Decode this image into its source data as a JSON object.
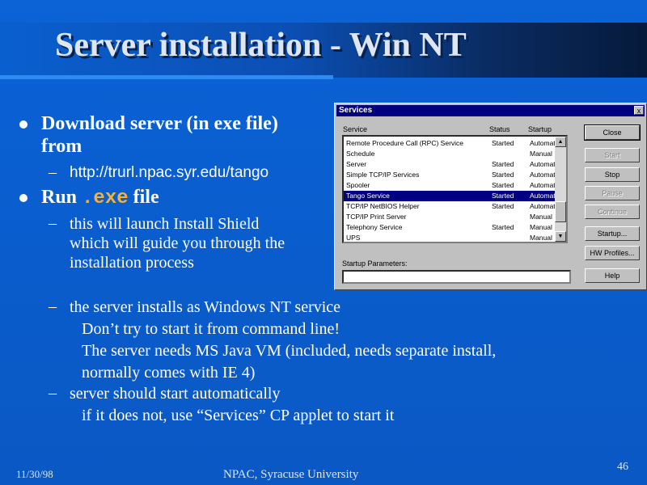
{
  "slide": {
    "title": "Server installation - Win NT",
    "bullet1": {
      "line1": "Download server (in exe file)",
      "line2": "from"
    },
    "sub1": "http://trurl.npac.syr.edu/tango",
    "bullet2": {
      "pre": "Run ",
      "code": ".exe",
      "post": " file"
    },
    "sub2": {
      "line1": "this will launch Install Shield",
      "line2": "which will guide you through the",
      "line3": "installation process"
    },
    "sub3": {
      "line1": "the server installs as Windows NT service",
      "line2": "Don’t try to start it from command line!",
      "line3": "The server needs MS Java VM (included, needs separate install,",
      "line4": "normally comes with IE 4)"
    },
    "sub4": {
      "line1": "server should start automatically",
      "line2": "if it does not, use “Services” CP applet to start it"
    },
    "dash": "–",
    "footer": {
      "date": "11/30/98",
      "org": "NPAC, Syracuse University",
      "page": "46"
    }
  },
  "dialog": {
    "title": "Services",
    "close_glyph": "x",
    "headers": {
      "service": "Service",
      "status": "Status",
      "startup": "Startup"
    },
    "rows": [
      {
        "service": "Remote Procedure Call (RPC) Service",
        "status": "Started",
        "startup": "Automatic"
      },
      {
        "service": "Schedule",
        "status": "",
        "startup": "Manual"
      },
      {
        "service": "Server",
        "status": "Started",
        "startup": "Automatic"
      },
      {
        "service": "Simple TCP/IP Services",
        "status": "Started",
        "startup": "Automatic"
      },
      {
        "service": "Spooler",
        "status": "Started",
        "startup": "Automatic"
      },
      {
        "service": "Tango Service",
        "status": "Started",
        "startup": "Automatic"
      },
      {
        "service": "TCP/IP NetBIOS Helper",
        "status": "Started",
        "startup": "Automatic"
      },
      {
        "service": "TCP/IP Print Server",
        "status": "",
        "startup": "Manual"
      },
      {
        "service": "Telephony Service",
        "status": "Started",
        "startup": "Manual"
      },
      {
        "service": "UPS",
        "status": "",
        "startup": "Manual"
      }
    ],
    "selected_row": 5,
    "buttons": {
      "close": "Close",
      "start": "Start",
      "stop": "Stop",
      "pause": "Pause",
      "continue": "Continue",
      "startup": "Startup...",
      "hw_profiles": "HW Profiles...",
      "help": "Help"
    },
    "params_label": "Startup Parameters:",
    "params_value": "",
    "scroll_up": "▲",
    "scroll_down": "▼"
  },
  "colors": {
    "background": "#0a5fcf",
    "code": "#f2b23c",
    "selection": "#000080"
  }
}
